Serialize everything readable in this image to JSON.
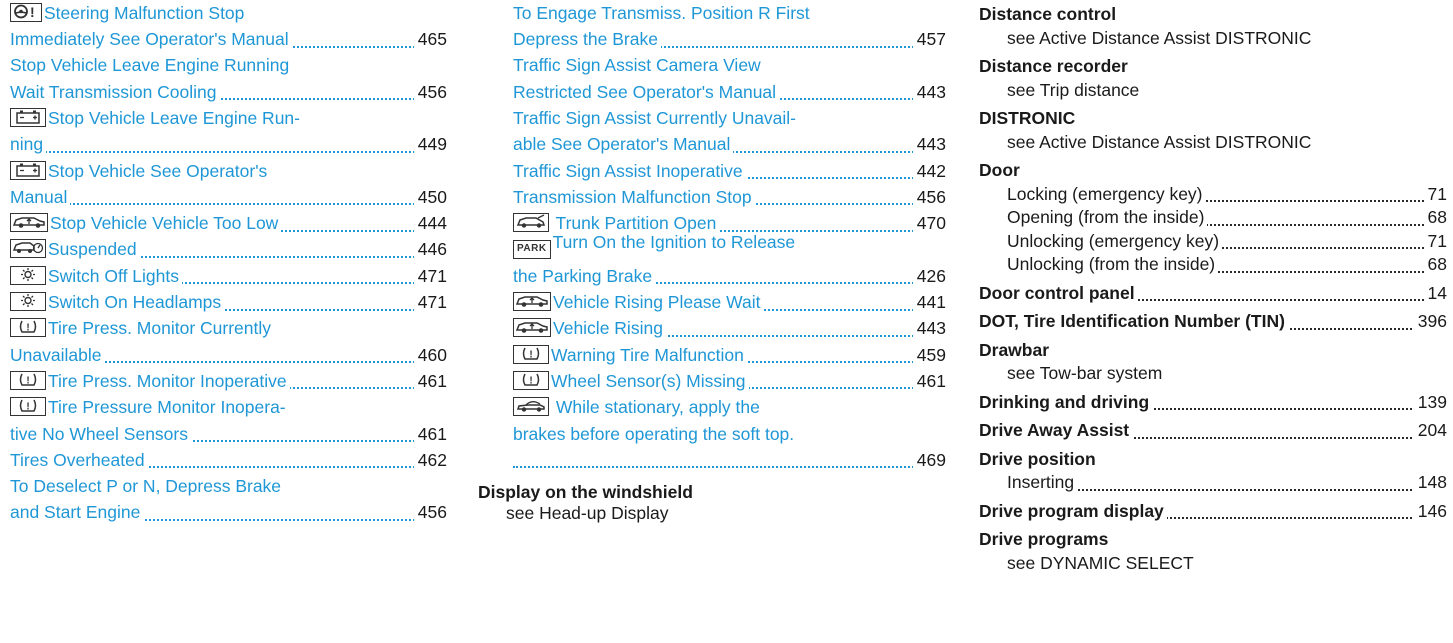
{
  "col1": [
    {
      "icon": "steering-warning",
      "line1": "Steering Malfunction Stop",
      "line2": "Immediately See Operator's Manual",
      "page": "465"
    },
    {
      "icon": null,
      "line1": "Stop Vehicle Leave Engine Running",
      "line2": "Wait Transmission Cooling",
      "page": "456"
    },
    {
      "icon": "battery",
      "line1": "Stop Vehicle Leave Engine Run-",
      "line2": "ning",
      "page": "449"
    },
    {
      "icon": "battery",
      "line1": "Stop Vehicle See Operator's",
      "line2": "Manual",
      "page": "450"
    },
    {
      "icon": "car-raise",
      "line1": null,
      "line2": "Stop Vehicle Vehicle Too Low",
      "page": "444"
    },
    {
      "icon": "suspension",
      "line1": null,
      "line2": "Suspended",
      "page": "446"
    },
    {
      "icon": "light",
      "line1": null,
      "line2": "Switch Off Lights",
      "page": "471"
    },
    {
      "icon": "light",
      "line1": null,
      "line2": "Switch On Headlamps",
      "page": "471"
    },
    {
      "icon": "tire-pressure",
      "line1": "Tire Press. Monitor Currently",
      "line2": "Unavailable",
      "page": "460"
    },
    {
      "icon": "tire-pressure",
      "line1": null,
      "line2": "Tire Press. Monitor Inoperative",
      "page": "461"
    },
    {
      "icon": "tire-pressure",
      "line1": "Tire Pressure Monitor Inopera-",
      "line2": "tive No Wheel Sensors",
      "page": "461"
    },
    {
      "icon": null,
      "line1": null,
      "line2": "Tires Overheated",
      "page": "462"
    },
    {
      "icon": null,
      "line1": "To Deselect P or N, Depress Brake",
      "line2": "and Start Engine",
      "page": "456"
    }
  ],
  "col2": [
    {
      "icon": null,
      "line1": "To Engage Transmiss. Position R First",
      "line2": "Depress the Brake",
      "page": "457"
    },
    {
      "icon": null,
      "line1": "Traffic Sign Assist Camera View",
      "line2": "Restricted See Operator's Manual",
      "page": "443"
    },
    {
      "icon": null,
      "line1": "Traffic Sign Assist Currently Unavail-",
      "line2": "able See Operator's Manual",
      "page": "443"
    },
    {
      "icon": null,
      "line1": null,
      "line2": "Traffic Sign Assist Inoperative",
      "page": "442"
    },
    {
      "icon": null,
      "line1": null,
      "line2": "Transmission Malfunction Stop",
      "page": "456"
    },
    {
      "icon": "trunk",
      "line1": null,
      "line2": " Trunk Partition Open",
      "page": "470"
    },
    {
      "icon": "park",
      "line1": "Turn On the Ignition to Release",
      "line2": "the Parking Brake",
      "page": "426"
    },
    {
      "icon": "car-raise",
      "line1": null,
      "line2": "Vehicle Rising Please Wait",
      "page": "441"
    },
    {
      "icon": "car-raise",
      "line1": null,
      "line2": "Vehicle Rising",
      "page": "443"
    },
    {
      "icon": "tire-pressure",
      "line1": null,
      "line2": "Warning Tire Malfunction",
      "page": "459"
    },
    {
      "icon": "tire-pressure",
      "line1": null,
      "line2": "Wheel Sensor(s) Missing",
      "page": "461"
    },
    {
      "icon": "convertible",
      "line1": " While stationary, apply the",
      "line2": "brakes before operating the soft top.",
      "line3": "",
      "page": "469"
    }
  ],
  "col2_heading": {
    "title": "Display on the windshield",
    "see": "see Head-up Display"
  },
  "park_label": "PARK",
  "col3": [
    {
      "type": "head",
      "text": "Distance control"
    },
    {
      "type": "see",
      "text": "see Active Distance Assist DISTRONIC"
    },
    {
      "type": "head",
      "text": "Distance recorder"
    },
    {
      "type": "see",
      "text": "see Trip distance"
    },
    {
      "type": "head",
      "text": "DISTRONIC"
    },
    {
      "type": "see",
      "text": "see Active Distance Assist DISTRONIC"
    },
    {
      "type": "head",
      "text": "Door"
    },
    {
      "type": "sub",
      "text": "Locking (emergency key)",
      "page": "71"
    },
    {
      "type": "sub",
      "text": "Opening (from the inside)",
      "page": "68"
    },
    {
      "type": "sub",
      "text": "Unlocking (emergency key)",
      "page": "71"
    },
    {
      "type": "sub",
      "text": "Unlocking (from the inside)",
      "page": "68"
    },
    {
      "type": "headpage",
      "text": "Door control panel",
      "page": "14"
    },
    {
      "type": "headpage",
      "text": "DOT, Tire Identification Number (TIN)",
      "page": "396"
    },
    {
      "type": "head",
      "text": "Drawbar"
    },
    {
      "type": "see",
      "text": "see Tow-bar system"
    },
    {
      "type": "headpage",
      "text": "Drinking and driving",
      "page": "139"
    },
    {
      "type": "headpage",
      "text": "Drive Away Assist",
      "page": "204"
    },
    {
      "type": "head",
      "text": "Drive position"
    },
    {
      "type": "sub",
      "text": "Inserting",
      "page": "148"
    },
    {
      "type": "headpage",
      "text": "Drive program display",
      "page": "146"
    },
    {
      "type": "head",
      "text": "Drive programs"
    },
    {
      "type": "see",
      "text": "see DYNAMIC SELECT"
    }
  ]
}
